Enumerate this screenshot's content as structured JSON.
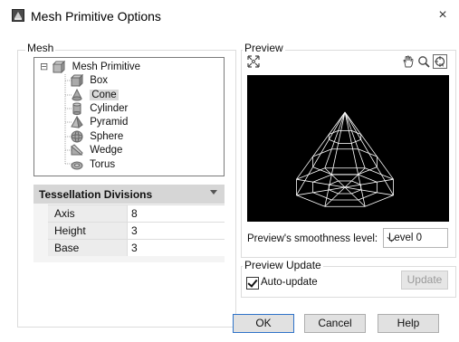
{
  "window": {
    "title": "Mesh Primitive Options",
    "close_glyph": "×"
  },
  "mesh_group": {
    "label": "Mesh"
  },
  "tree": {
    "root": {
      "label": "Mesh Primitive",
      "expander": "⊟",
      "icon": "mesh-primitive-icon"
    },
    "items": [
      {
        "label": "Box",
        "icon": "box-icon",
        "selected": false
      },
      {
        "label": "Cone",
        "icon": "cone-icon",
        "selected": true
      },
      {
        "label": "Cylinder",
        "icon": "cylinder-icon",
        "selected": false
      },
      {
        "label": "Pyramid",
        "icon": "pyramid-icon",
        "selected": false
      },
      {
        "label": "Sphere",
        "icon": "sphere-icon",
        "selected": false
      },
      {
        "label": "Wedge",
        "icon": "wedge-icon",
        "selected": false
      },
      {
        "label": "Torus",
        "icon": "torus-icon",
        "selected": false
      }
    ]
  },
  "tessellation": {
    "title": "Tessellation Divisions",
    "rows": [
      {
        "key": "Axis",
        "value": "8"
      },
      {
        "key": "Height",
        "value": "3"
      },
      {
        "key": "Base",
        "value": "3"
      }
    ]
  },
  "preview_group": {
    "label": "Preview",
    "tools": [
      "zoom-extents-icon",
      "pan-hand-icon",
      "zoom-magnifier-icon",
      "orbit-icon"
    ]
  },
  "smoothness": {
    "label": "Preview's smoothness level:",
    "selected": "Level 0"
  },
  "preview_update": {
    "label": "Preview Update",
    "auto_update_label": "Auto-update",
    "auto_update_checked": true,
    "update_button": "Update"
  },
  "buttons": {
    "ok": "OK",
    "cancel": "Cancel",
    "help": "Help"
  }
}
